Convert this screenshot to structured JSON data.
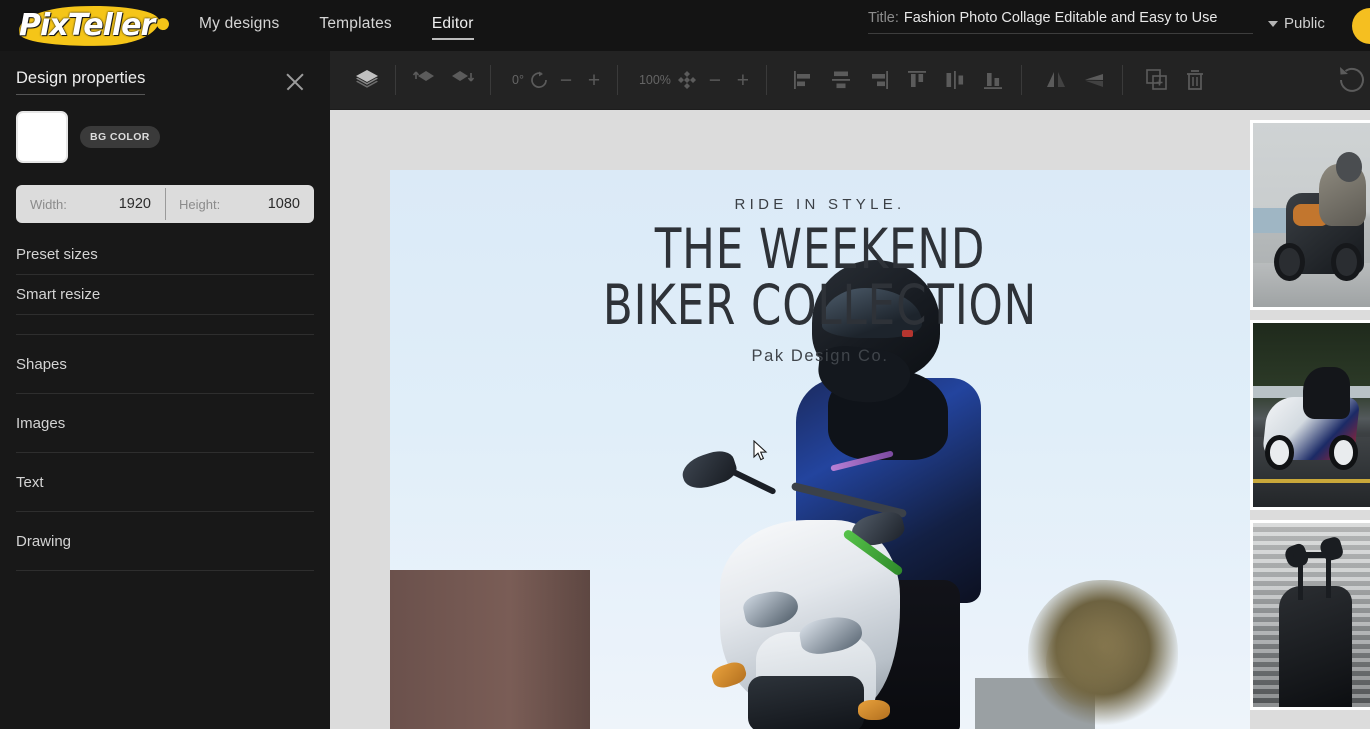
{
  "app": {
    "brand": "PixTeller",
    "nav": [
      {
        "label": "My designs",
        "active": false
      },
      {
        "label": "Templates",
        "active": false
      },
      {
        "label": "Editor",
        "active": true
      }
    ],
    "title_label": "Title:",
    "title_value": "Fashion Photo Collage Editable and Easy to Use",
    "visibility": "Public",
    "avatar_color": "#f5bf20"
  },
  "sidebar": {
    "panel_title": "Design properties",
    "close_icon": "close-icon",
    "bg_color_badge": "BG COLOR",
    "bg_color_value": "#ffffff",
    "dimensions": {
      "width_label": "Width:",
      "width_value": "1920",
      "height_label": "Height:",
      "height_value": "1080"
    },
    "items": [
      {
        "label": "Preset sizes"
      },
      {
        "label": "Smart resize"
      },
      {
        "label": "Shapes"
      },
      {
        "label": "Images"
      },
      {
        "label": "Text"
      },
      {
        "label": "Drawing"
      }
    ]
  },
  "toolbar": {
    "layers_icon": "layers-icon",
    "bring_forward_icon": "bring-forward-icon",
    "send_backward_icon": "send-backward-icon",
    "rotation_value": "0°",
    "rotate_icon": "rotate-icon",
    "rotation_minus": "−",
    "rotation_plus": "+",
    "zoom_value": "100%",
    "scale_icon": "scale-icon",
    "zoom_minus": "−",
    "zoom_plus": "+",
    "align_left_icon": "align-left-icon",
    "align_center_h_icon": "align-center-horizontal-icon",
    "align_right_icon": "align-right-icon",
    "align_top_icon": "align-top-icon",
    "align_middle_icon": "align-middle-icon",
    "align_bottom_icon": "align-bottom-icon",
    "flip_horizontal_icon": "flip-horizontal-icon",
    "flip_vertical_icon": "flip-vertical-icon",
    "duplicate_icon": "duplicate-icon",
    "delete_icon": "trash-icon",
    "undo_icon": "undo-icon"
  },
  "canvas": {
    "kicker": "RIDE IN STYLE.",
    "headline_line1": "THE WEEKEND",
    "headline_line2": "BIKER COLLECTION",
    "subline": "Pak Design Co.",
    "background_color": "#dbeaf7",
    "text_color": "#2e3238"
  },
  "thumbnails": [
    {
      "name": "cruiser-by-the-sea"
    },
    {
      "name": "sportbike-on-track"
    },
    {
      "name": "motorcycle-front-dark"
    }
  ],
  "workspace": {
    "background_color": "#dcdcdc"
  }
}
